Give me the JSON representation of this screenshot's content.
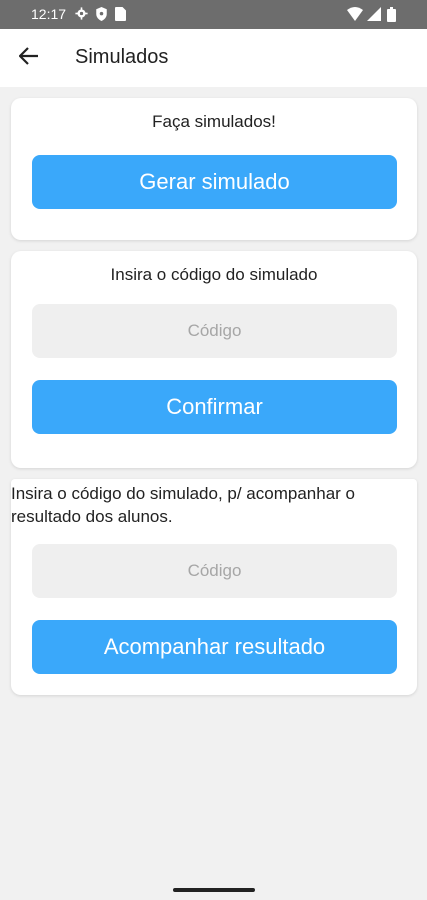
{
  "status_bar": {
    "time": "12:17",
    "icons_left": [
      "gear-icon",
      "shield-icon",
      "sim-card-icon"
    ],
    "icons_right": [
      "wifi-icon",
      "signal-icon",
      "battery-icon"
    ]
  },
  "app_bar": {
    "back_icon": "arrow-left-icon",
    "title": "Simulados"
  },
  "card_generate": {
    "heading": "Faça simulados!",
    "button_label": "Gerar simulado"
  },
  "card_enter_code": {
    "heading": "Insira o código do simulado",
    "input_placeholder": "Código",
    "input_value": "",
    "button_label": "Confirmar"
  },
  "card_track": {
    "heading": "Insira o código do simulado, p/ acompanhar o resultado dos alunos.",
    "input_placeholder": "Código",
    "input_value": "",
    "button_label": "Acompanhar resultado"
  },
  "colors": {
    "accent": "#3aa8fa",
    "status_bar": "#6d6d6d",
    "background": "#f1f1f1",
    "input_bg": "#efefef"
  }
}
